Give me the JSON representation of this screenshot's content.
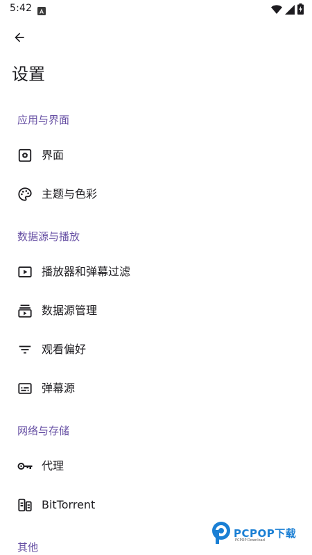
{
  "status_bar": {
    "time": "5:42",
    "notification_icon": "a-notification-icon",
    "icons": [
      "wifi-icon",
      "cellular-signal-icon",
      "battery-charging-icon"
    ]
  },
  "app_bar": {
    "back_icon": "arrow-back-icon"
  },
  "page": {
    "title": "设置"
  },
  "sections": [
    {
      "header": "应用与界面",
      "items": [
        {
          "label": "界面",
          "icon": "settings-box-icon"
        },
        {
          "label": "主题与色彩",
          "icon": "palette-icon"
        }
      ]
    },
    {
      "header": "数据源与播放",
      "items": [
        {
          "label": "播放器和弹幕过滤",
          "icon": "play-box-icon"
        },
        {
          "label": "数据源管理",
          "icon": "subscriptions-icon"
        },
        {
          "label": "观看偏好",
          "icon": "filter-list-icon"
        },
        {
          "label": "弹幕源",
          "icon": "subtitles-icon"
        }
      ]
    },
    {
      "header": "网络与存储",
      "items": [
        {
          "label": "代理",
          "icon": "vpn-key-icon"
        },
        {
          "label": "BitTorrent",
          "icon": "torrent-devices-icon"
        }
      ]
    },
    {
      "header": "其他",
      "items": []
    }
  ],
  "watermark": {
    "text": "PCPOP下载",
    "subtext": "PCPOP Download"
  },
  "colors": {
    "accent": "#6750a4",
    "text": "#1c1b1f",
    "icon": "#1c1b1f",
    "watermark": "#1a7fd4"
  }
}
